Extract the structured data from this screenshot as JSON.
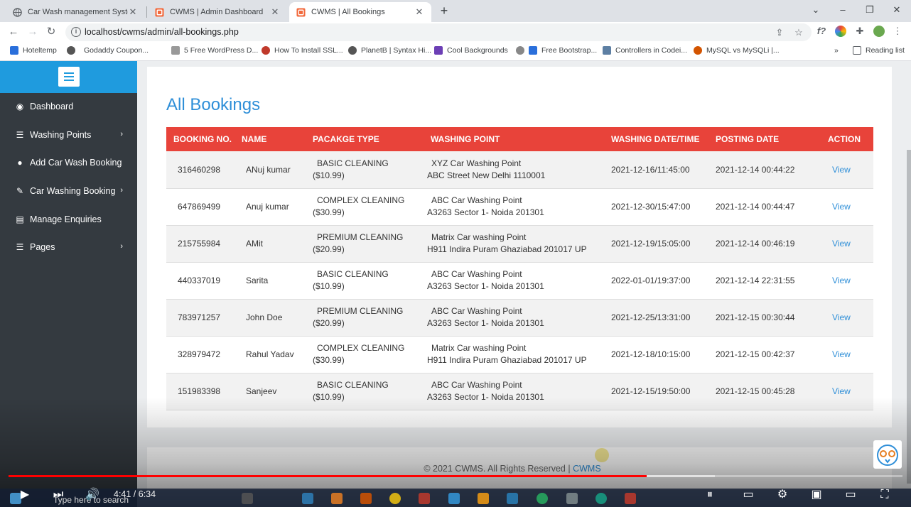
{
  "browser": {
    "tabs": [
      {
        "title": "Car Wash management System |",
        "active": false
      },
      {
        "title": "CWMS | Admin Dashboard",
        "active": false
      },
      {
        "title": "CWMS | All Bookings",
        "active": true
      }
    ],
    "url": "localhost/cwms/admin/all-bookings.php",
    "bookmarks": [
      "Hoteltemp",
      "Godaddy Coupon...",
      "5 Free WordPress D...",
      "How To Install SSL...",
      "PlanetB | Syntax Hi...",
      "Cool Backgrounds",
      "Free Bootstrap...",
      "Controllers in Codei...",
      "MySQL vs MySQLi |..."
    ],
    "reading_list": "Reading list",
    "more_bookmarks": "»"
  },
  "sidebar": {
    "items": [
      {
        "label": "Dashboard",
        "icon": "dashboard-icon",
        "has_submenu": false
      },
      {
        "label": "Washing Points",
        "icon": "list-icon",
        "has_submenu": true
      },
      {
        "label": "Add Car Wash Booking",
        "icon": "user-icon",
        "has_submenu": false
      },
      {
        "label": "Car Washing Booking",
        "icon": "edit-icon",
        "has_submenu": true
      },
      {
        "label": "Manage Enquiries",
        "icon": "file-icon",
        "has_submenu": false
      },
      {
        "label": "Pages",
        "icon": "list-icon",
        "has_submenu": true
      }
    ]
  },
  "main": {
    "title": "All Bookings",
    "columns": [
      "BOOKING NO.",
      "NAME",
      "PACAKGE TYPE",
      "WASHING POINT",
      "WASHING DATE/TIME",
      "POSTING DATE",
      "ACTION"
    ],
    "rows": [
      {
        "booking_no": "316460298",
        "name": "ANuj kumar",
        "package": "BASIC CLEANING",
        "price": "($10.99)",
        "point_name": "XYZ Car Washing Point",
        "point_address": "ABC Street New Delhi 1110001",
        "wash_datetime": "2021-12-16/11:45:00",
        "posting_date": "2021-12-14 00:44:22",
        "action": "View"
      },
      {
        "booking_no": "647869499",
        "name": "Anuj kumar",
        "package": "COMPLEX CLEANING",
        "price": "($30.99)",
        "point_name": "ABC Car Washing Point",
        "point_address": "A3263 Sector 1- Noida 201301",
        "wash_datetime": "2021-12-30/15:47:00",
        "posting_date": "2021-12-14 00:44:47",
        "action": "View"
      },
      {
        "booking_no": "215755984",
        "name": "AMit",
        "package": "PREMIUM CLEANING",
        "price": "($20.99)",
        "point_name": "Matrix Car washing Point",
        "point_address": "H911 Indira Puram Ghaziabad 201017 UP",
        "wash_datetime": "2021-12-19/15:05:00",
        "posting_date": "2021-12-14 00:46:19",
        "action": "View"
      },
      {
        "booking_no": "440337019",
        "name": "Sarita",
        "package": "BASIC CLEANING",
        "price": "($10.99)",
        "point_name": "ABC Car Washing Point",
        "point_address": "A3263 Sector 1- Noida 201301",
        "wash_datetime": "2022-01-01/19:37:00",
        "posting_date": "2021-12-14 22:31:55",
        "action": "View"
      },
      {
        "booking_no": "783971257",
        "name": "John Doe",
        "package": "PREMIUM CLEANING",
        "price": "($20.99)",
        "point_name": "ABC Car Washing Point",
        "point_address": "A3263 Sector 1- Noida 201301",
        "wash_datetime": "2021-12-25/13:31:00",
        "posting_date": "2021-12-15 00:30:44",
        "action": "View"
      },
      {
        "booking_no": "328979472",
        "name": "Rahul Yadav",
        "package": "COMPLEX CLEANING",
        "price": "($30.99)",
        "point_name": "Matrix Car washing Point",
        "point_address": "H911 Indira Puram Ghaziabad 201017 UP",
        "wash_datetime": "2021-12-18/10:15:00",
        "posting_date": "2021-12-15 00:42:37",
        "action": "View"
      },
      {
        "booking_no": "151983398",
        "name": "Sanjeev",
        "package": "BASIC CLEANING",
        "price": "($10.99)",
        "point_name": "ABC Car Washing Point",
        "point_address": "A3263 Sector 1- Noida 201301",
        "wash_datetime": "2021-12-15/19:50:00",
        "posting_date": "2021-12-15 00:45:28",
        "action": "View"
      }
    ]
  },
  "footer": {
    "text": "© 2021 CWMS. All Rights Reserved | ",
    "brand": "CWMS"
  },
  "video": {
    "timecode": "4:41 / 6:34",
    "progress": 0.714,
    "buffered": 0.79,
    "search_hint": "Type here to search"
  },
  "colors": {
    "accent": "#2f8fd8",
    "table_header": "#e8433a",
    "sidebar": "#343a40",
    "sidebar_header": "#1f9bde",
    "progress": "#ff0000"
  }
}
